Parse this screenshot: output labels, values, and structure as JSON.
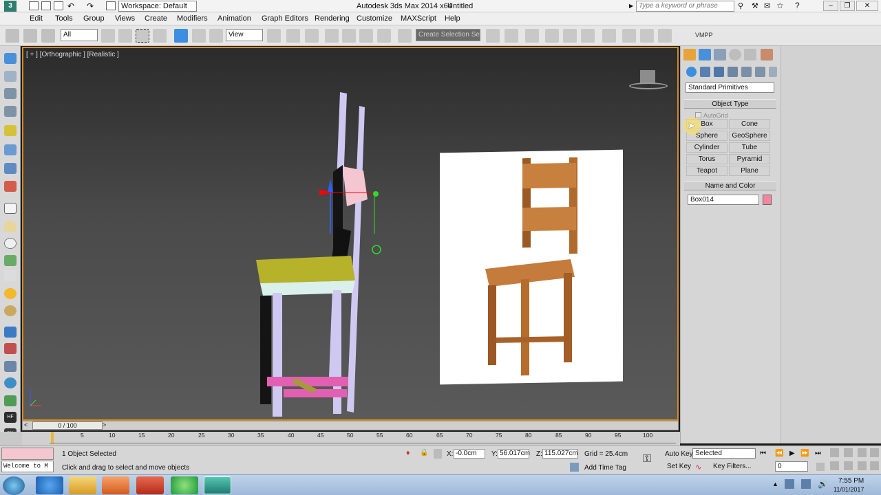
{
  "title_bar": {
    "logo": "3dsmax-logo-icon",
    "workspace": "Workspace: Default",
    "app_title": "Autodesk 3ds Max  2014 x64",
    "doc_title": "Untitled",
    "search_placeholder": "Type a keyword or phrase"
  },
  "menu": [
    "Edit",
    "Tools",
    "Group",
    "Views",
    "Create",
    "Modifiers",
    "Animation",
    "Graph Editors",
    "Rendering",
    "Customize",
    "MAXScript",
    "Help"
  ],
  "toolbar": {
    "selection_filter": "All",
    "reference_coord": "View",
    "named_selection_placeholder": "Create Selection Se",
    "vmpp": "VMPP"
  },
  "viewport": {
    "label": "[ + ] [Orthographic ] [Realistic ]"
  },
  "command_panel": {
    "primitive_type": "Standard Primitives",
    "object_type_title": "Object Type",
    "autogrid_label": "AutoGrid",
    "buttons": [
      "Box",
      "Cone",
      "Sphere",
      "GeoSphere",
      "Cylinder",
      "Tube",
      "Torus",
      "Pyramid",
      "Teapot",
      "Plane"
    ],
    "name_and_color_title": "Name and Color",
    "object_name": "Box014",
    "object_color": "#f4859f"
  },
  "time_slider": {
    "position": "0 / 100",
    "ticks": [
      "5",
      "10",
      "15",
      "20",
      "25",
      "30",
      "35",
      "40",
      "45",
      "50",
      "55",
      "60",
      "65",
      "70",
      "75",
      "80",
      "85",
      "90",
      "95",
      "100"
    ]
  },
  "status": {
    "listener_prompt": "Welcome to M",
    "selection_status": "1 Object Selected",
    "prompt": "Click and drag to select and move objects",
    "x_label": "X:",
    "x_value": "-0.0cm",
    "y_label": "Y:",
    "y_value": "56.017cm",
    "z_label": "Z:",
    "z_value": "115.027cm",
    "grid": "Grid = 25.4cm",
    "add_time_tag": "Add Time Tag",
    "auto_key": "Auto Key",
    "set_key": "Set Key",
    "selected_combo": "Selected",
    "key_filters": "Key Filters...",
    "frame": "0"
  },
  "taskbar": {
    "time": "7:55 PM",
    "date": "11/01/2017"
  }
}
